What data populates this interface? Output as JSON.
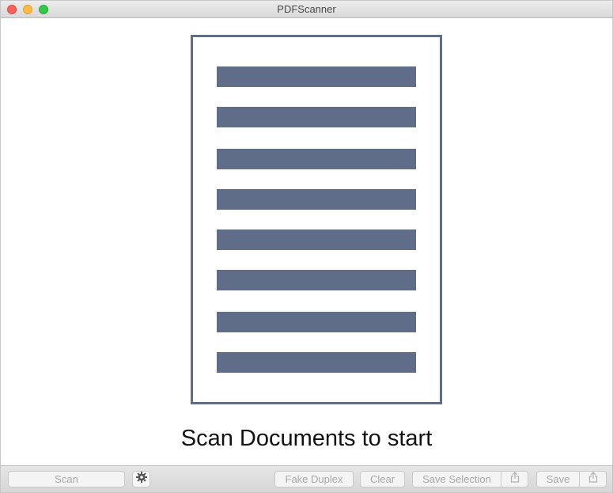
{
  "window": {
    "title": "PDFScanner"
  },
  "content": {
    "placeholder_text": "Scan Documents to start",
    "illustration_icon": "document-lines-icon",
    "line_color": "#5f6d89",
    "frame_color": "#5f6d89"
  },
  "toolbar": {
    "scan_label": "Scan",
    "settings_icon": "gear-icon",
    "fake_duplex_label": "Fake Duplex",
    "clear_label": "Clear",
    "save_selection_label": "Save Selection",
    "share_selection_icon": "share-icon",
    "save_label": "Save",
    "share_icon": "share-icon"
  }
}
